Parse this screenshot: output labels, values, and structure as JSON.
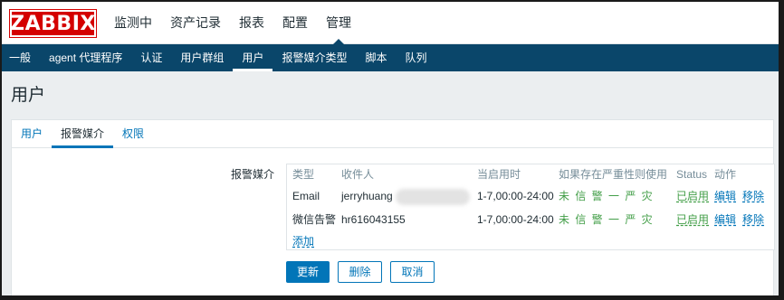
{
  "header": {
    "logo_text": "ZABBIX",
    "nav": [
      "监测中",
      "资产记录",
      "报表",
      "配置",
      "管理"
    ],
    "active_nav": "管理"
  },
  "subnav": {
    "items": [
      "一般",
      "agent 代理程序",
      "认证",
      "用户群组",
      "用户",
      "报警媒介类型",
      "脚本",
      "队列"
    ],
    "active": "用户"
  },
  "page": {
    "title": "用户"
  },
  "tabs": {
    "items": [
      "用户",
      "报警媒介",
      "权限"
    ],
    "active": "报警媒介"
  },
  "media": {
    "field_label": "报警媒介",
    "columns": {
      "type": "类型",
      "send_to": "收件人",
      "when_active": "当启用时",
      "severity": "如果存在严重性则使用",
      "status": "Status",
      "action": "动作"
    },
    "rows": [
      {
        "type": "Email",
        "send_to": "jerryhuang",
        "when_active": "1-7,00:00-24:00",
        "severity": "未 信 警 一 严 灾",
        "status": "已启用",
        "edit": "编辑",
        "remove": "移除"
      },
      {
        "type": "微信告警",
        "send_to": "hr616043155",
        "when_active": "1-7,00:00-24:00",
        "severity": "未 信 警 一 严 灾",
        "status": "已启用",
        "edit": "编辑",
        "remove": "移除"
      }
    ],
    "add_label": "添加"
  },
  "buttons": {
    "update": "更新",
    "delete": "删除",
    "cancel": "取消"
  },
  "colors": {
    "brand_red": "#d40000",
    "nav_blue": "#0a466a",
    "link_blue": "#0275b8",
    "enabled_green": "#429e47"
  }
}
